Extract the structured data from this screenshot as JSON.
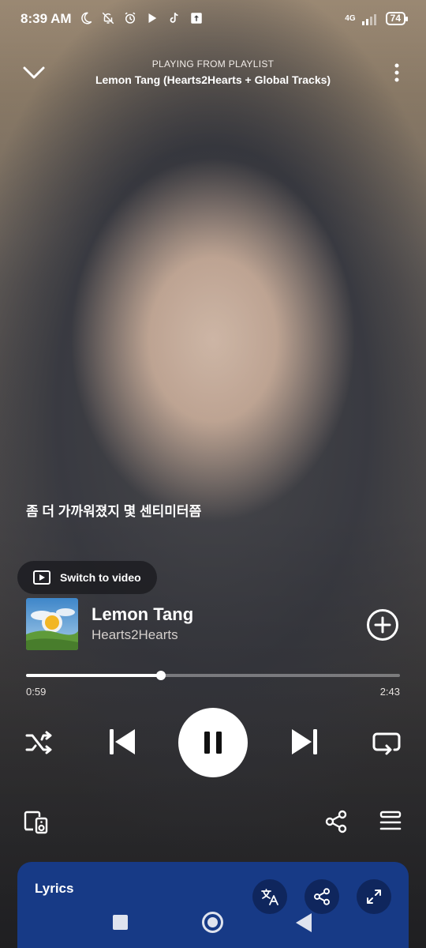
{
  "status_bar": {
    "time": "8:39 AM",
    "network": "4G",
    "battery": "74",
    "icons": [
      "moon-icon",
      "bell-off-icon",
      "alarm-icon",
      "play-store-icon",
      "tiktok-icon",
      "upload-box-icon"
    ]
  },
  "header": {
    "subtitle": "PLAYING FROM PLAYLIST",
    "title": "Lemon Tang (Hearts2Hearts + Global Tracks)"
  },
  "lyric_preview": "좀 더 가까워졌지 몇 센티미터쯤",
  "switch_video": {
    "label": "Switch to video"
  },
  "track": {
    "title": "Lemon Tang",
    "artist": "Hearts2Hearts"
  },
  "playback": {
    "elapsed": "0:59",
    "total": "2:43",
    "progress_fraction": 0.36
  },
  "lyrics_panel": {
    "label": "Lyrics"
  },
  "colors": {
    "lyrics_panel_bg": "#173a86",
    "accent": "#ffffff"
  }
}
